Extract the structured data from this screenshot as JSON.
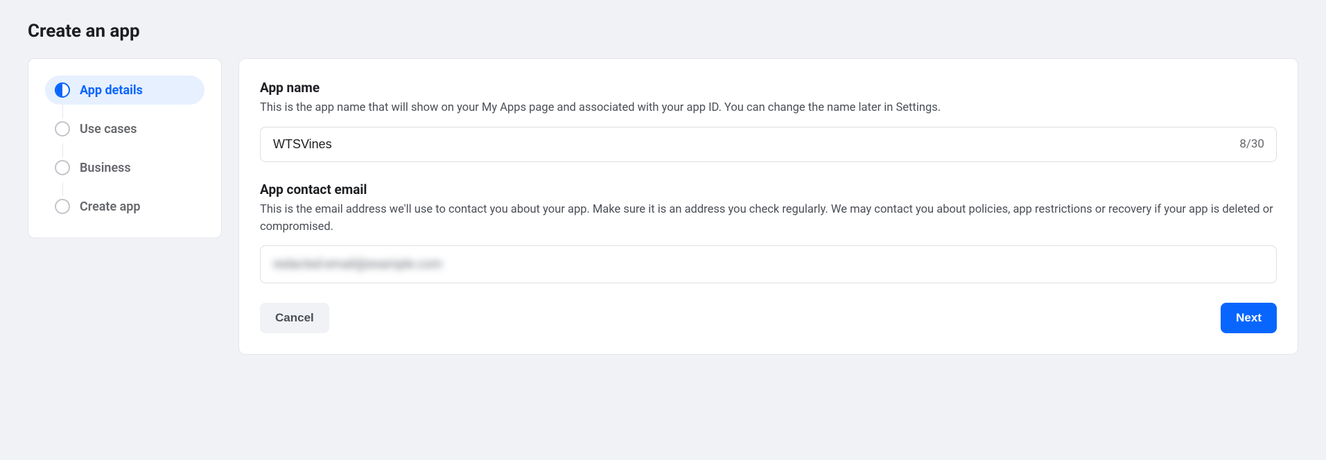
{
  "page": {
    "title": "Create an app"
  },
  "steps": [
    {
      "label": "App details",
      "active": true
    },
    {
      "label": "Use cases",
      "active": false
    },
    {
      "label": "Business",
      "active": false
    },
    {
      "label": "Create app",
      "active": false
    }
  ],
  "form": {
    "appName": {
      "title": "App name",
      "description": "This is the app name that will show on your My Apps page and associated with your app ID. You can change the name later in Settings.",
      "value": "WTSVines",
      "counter": "8/30"
    },
    "contactEmail": {
      "title": "App contact email",
      "description": "This is the email address we'll use to contact you about your app. Make sure it is an address you check regularly. We may contact you about policies, app restrictions or recovery if your app is deleted or compromised.",
      "value": "redacted-email@example.com"
    }
  },
  "buttons": {
    "cancel": "Cancel",
    "next": "Next"
  }
}
